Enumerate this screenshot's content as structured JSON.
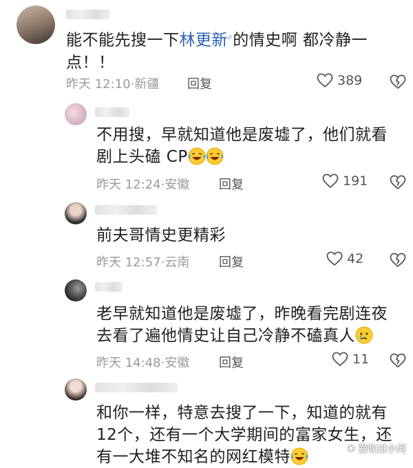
{
  "comments": [
    {
      "line1_pre": "能不能先搜一下",
      "link": "林更新",
      "line1_post": "的情史啊 都冷静一",
      "line2": "点！！",
      "time": "昨天 12:10",
      "location": "新疆",
      "reply": "回复",
      "likes": "389"
    },
    {
      "line1": "不用搜，早就知道他是废墟了，他们就看",
      "line2": "剧上头磕 CP",
      "time": "昨天 12:24",
      "location": "安徽",
      "reply": "回复",
      "likes": "191"
    },
    {
      "line1": "前夫哥情史更精彩",
      "time": "昨天 12:57",
      "location": "云南",
      "reply": "回复",
      "likes": "42"
    },
    {
      "line1": "老早就知道他是废墟了，昨晚看完剧连夜",
      "line2": "去看了遍他情史让自己冷静不磕真人",
      "time": "昨天 14:48",
      "location": "安徽",
      "reply": "回复",
      "likes": "11"
    },
    {
      "line1": "和你一样，特意去搜了一下，知道的就有",
      "line2": "12个，还有一个大学期间的富家女生，还",
      "line3": "有一大堆不知名的网红模特"
    }
  ],
  "separator": "·",
  "watermark": "爱吹过小河",
  "icons": {
    "like": "heart-icon",
    "dislike": "broken-heart-icon",
    "search": "search-icon",
    "laugh": "laughing-emoji-icon",
    "cry": "crying-emoji-icon"
  }
}
